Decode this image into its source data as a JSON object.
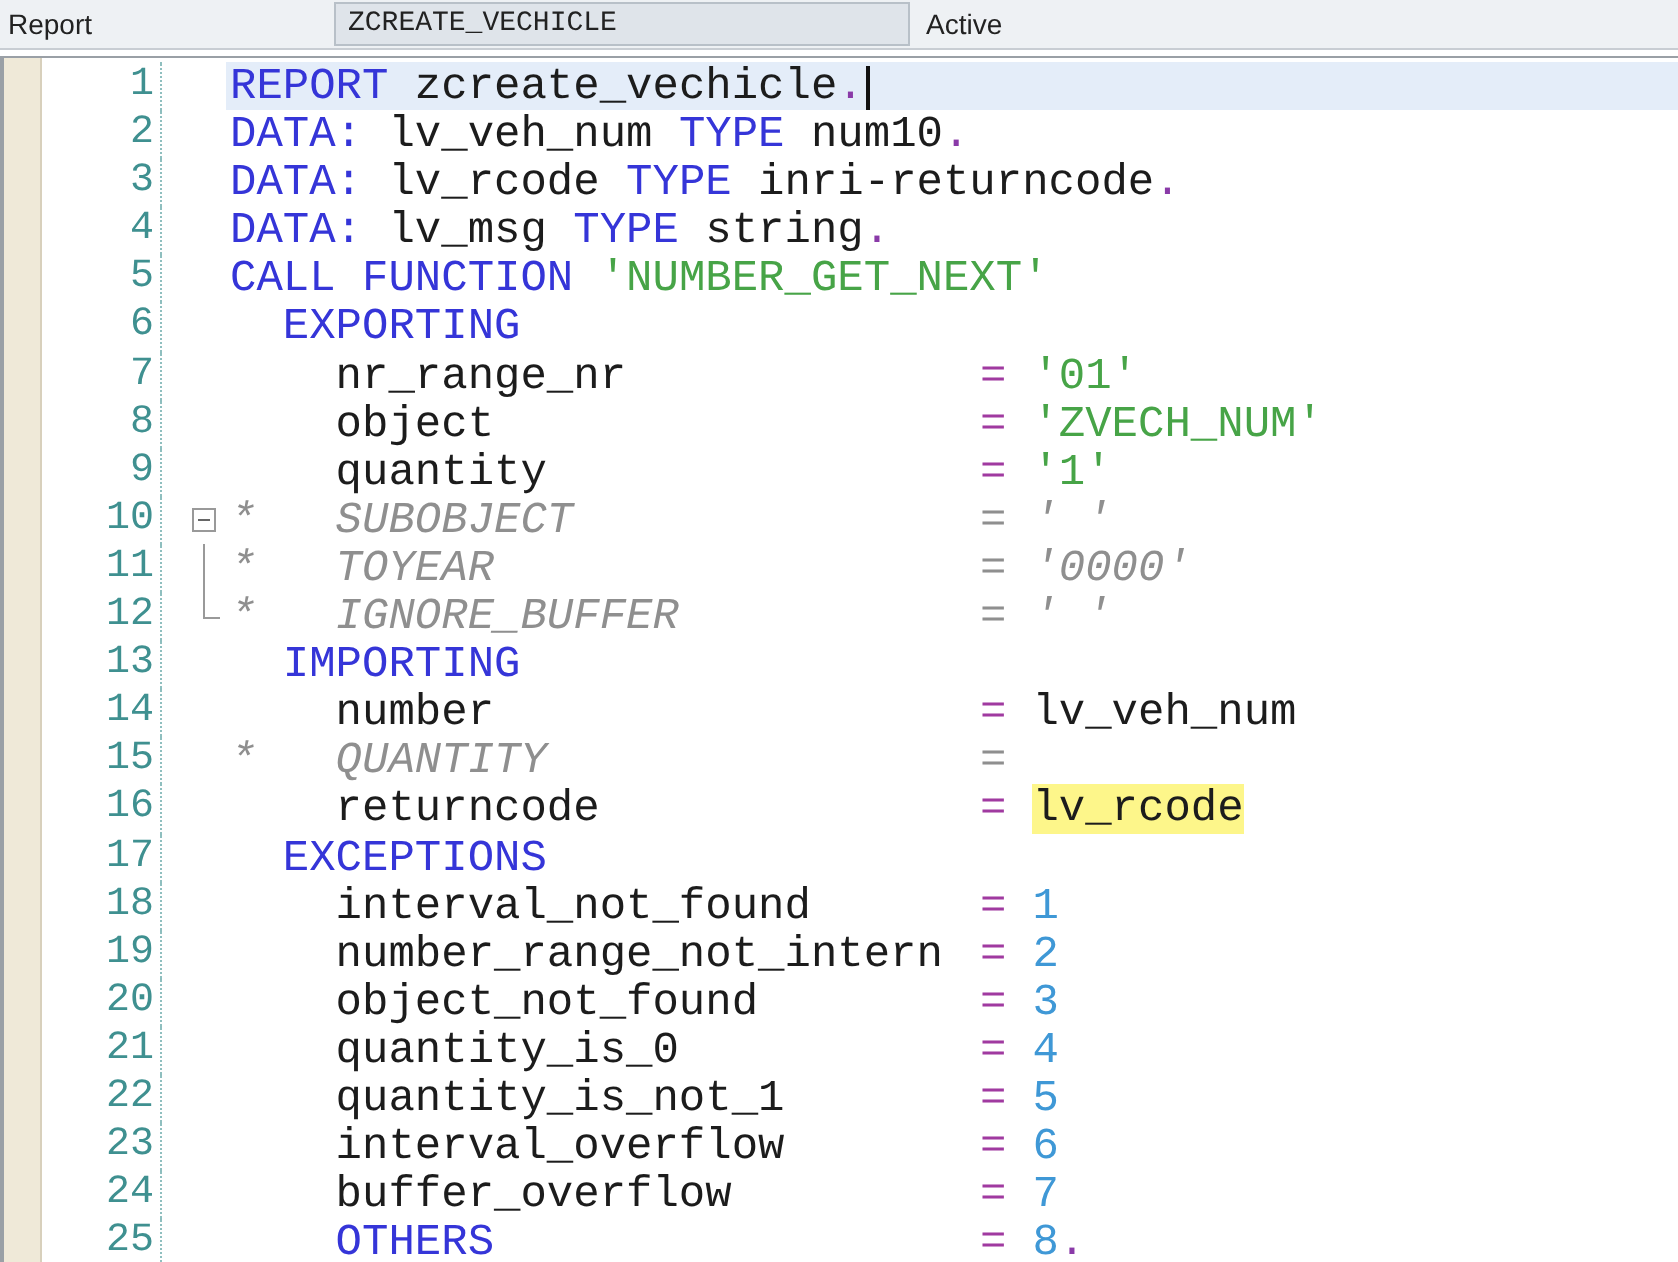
{
  "header": {
    "type_label": "Report",
    "program_name": "ZCREATE_VECHICLE",
    "status": "Active"
  },
  "lines": [
    {
      "number": "1",
      "current": true,
      "code": [
        {
          "text": "REPORT",
          "kind": "keyword"
        },
        {
          "text": " zcreate_vechicle",
          "kind": "plain"
        },
        {
          "text": ".",
          "kind": "punct"
        }
      ]
    },
    {
      "number": "2",
      "current": false,
      "code": [
        {
          "text": "DATA:",
          "kind": "keyword"
        },
        {
          "text": " lv_veh_num ",
          "kind": "plain"
        },
        {
          "text": "TYPE",
          "kind": "keyword"
        },
        {
          "text": " num10",
          "kind": "plain"
        },
        {
          "text": ".",
          "kind": "punct"
        }
      ]
    },
    {
      "number": "3",
      "current": false,
      "code": [
        {
          "text": "DATA:",
          "kind": "keyword"
        },
        {
          "text": " lv_rcode ",
          "kind": "plain"
        },
        {
          "text": "TYPE",
          "kind": "keyword"
        },
        {
          "text": " inri-returncode",
          "kind": "plain"
        },
        {
          "text": ".",
          "kind": "punct"
        }
      ]
    },
    {
      "number": "4",
      "current": false,
      "code": [
        {
          "text": "DATA:",
          "kind": "keyword"
        },
        {
          "text": " lv_msg ",
          "kind": "plain"
        },
        {
          "text": "TYPE",
          "kind": "keyword"
        },
        {
          "text": " string",
          "kind": "plain"
        },
        {
          "text": ".",
          "kind": "punct"
        }
      ]
    },
    {
      "number": "5",
      "current": false,
      "code": [
        {
          "text": "CALL FUNCTION ",
          "kind": "keyword"
        },
        {
          "text": "'NUMBER_GET_NEXT'",
          "kind": "string"
        }
      ]
    },
    {
      "number": "6",
      "current": false,
      "code": [
        {
          "text": "  EXPORTING",
          "kind": "keyword"
        }
      ]
    },
    {
      "number": "7",
      "current": false,
      "code": [
        {
          "text": "    nr_range_nr",
          "kind": "plain"
        }
      ],
      "assign": {
        "op": {
          "text": "=",
          "kind": "operator"
        },
        "value": [
          {
            "text": "'01'",
            "kind": "string"
          }
        ]
      }
    },
    {
      "number": "8",
      "current": false,
      "code": [
        {
          "text": "    object",
          "kind": "plain"
        }
      ],
      "assign": {
        "op": {
          "text": "=",
          "kind": "operator"
        },
        "value": [
          {
            "text": "'ZVECH_NUM'",
            "kind": "string"
          }
        ]
      }
    },
    {
      "number": "9",
      "current": false,
      "code": [
        {
          "text": "    quantity",
          "kind": "plain"
        }
      ],
      "assign": {
        "op": {
          "text": "=",
          "kind": "operator"
        },
        "value": [
          {
            "text": "'1'",
            "kind": "string"
          }
        ]
      }
    },
    {
      "number": "10",
      "current": false,
      "fold": {
        "kind": "start"
      },
      "code": [
        {
          "text": "*   SUBOBJECT",
          "kind": "comment"
        }
      ],
      "assign": {
        "op": {
          "text": "=",
          "kind": "comment"
        },
        "value": [
          {
            "text": "' '",
            "kind": "comment"
          }
        ]
      }
    },
    {
      "number": "11",
      "current": false,
      "fold": {
        "kind": "middle"
      },
      "code": [
        {
          "text": "*   TOYEAR",
          "kind": "comment"
        }
      ],
      "assign": {
        "op": {
          "text": "=",
          "kind": "comment"
        },
        "value": [
          {
            "text": "'0000'",
            "kind": "comment"
          }
        ]
      }
    },
    {
      "number": "12",
      "current": false,
      "fold": {
        "kind": "end"
      },
      "code": [
        {
          "text": "*   IGNORE_BUFFER",
          "kind": "comment"
        }
      ],
      "assign": {
        "op": {
          "text": "=",
          "kind": "comment"
        },
        "value": [
          {
            "text": "' '",
            "kind": "comment"
          }
        ]
      }
    },
    {
      "number": "13",
      "current": false,
      "code": [
        {
          "text": "  IMPORTING",
          "kind": "keyword"
        }
      ]
    },
    {
      "number": "14",
      "current": false,
      "code": [
        {
          "text": "    number",
          "kind": "plain"
        }
      ],
      "assign": {
        "op": {
          "text": "=",
          "kind": "operator"
        },
        "value": [
          {
            "text": "lv_veh_num",
            "kind": "plain"
          }
        ]
      }
    },
    {
      "number": "15",
      "current": false,
      "code": [
        {
          "text": "*   QUANTITY",
          "kind": "comment"
        }
      ],
      "assign": {
        "op": {
          "text": "=",
          "kind": "comment"
        }
      }
    },
    {
      "number": "16",
      "current": false,
      "code": [
        {
          "text": "    returncode",
          "kind": "plain"
        }
      ],
      "assign": {
        "op": {
          "text": "=",
          "kind": "operator"
        },
        "value": [
          {
            "text": "lv_rcode",
            "kind": "plain"
          }
        ],
        "highlighted": true
      }
    },
    {
      "number": "17",
      "current": false,
      "code": [
        {
          "text": "  EXCEPTIONS",
          "kind": "keyword"
        }
      ]
    },
    {
      "number": "18",
      "current": false,
      "code": [
        {
          "text": "    interval_not_found",
          "kind": "plain"
        }
      ],
      "assign": {
        "op": {
          "text": "=",
          "kind": "operator"
        },
        "value": [
          {
            "text": "1",
            "kind": "number"
          }
        ]
      }
    },
    {
      "number": "19",
      "current": false,
      "code": [
        {
          "text": "    number_range_not_intern",
          "kind": "plain"
        }
      ],
      "assign": {
        "op": {
          "text": "=",
          "kind": "operator"
        },
        "value": [
          {
            "text": "2",
            "kind": "number"
          }
        ]
      }
    },
    {
      "number": "20",
      "current": false,
      "code": [
        {
          "text": "    object_not_found",
          "kind": "plain"
        }
      ],
      "assign": {
        "op": {
          "text": "=",
          "kind": "operator"
        },
        "value": [
          {
            "text": "3",
            "kind": "number"
          }
        ]
      }
    },
    {
      "number": "21",
      "current": false,
      "code": [
        {
          "text": "    quantity_is_0",
          "kind": "plain"
        }
      ],
      "assign": {
        "op": {
          "text": "=",
          "kind": "operator"
        },
        "value": [
          {
            "text": "4",
            "kind": "number"
          }
        ]
      }
    },
    {
      "number": "22",
      "current": false,
      "code": [
        {
          "text": "    quantity_is_not_1",
          "kind": "plain"
        }
      ],
      "assign": {
        "op": {
          "text": "=",
          "kind": "operator"
        },
        "value": [
          {
            "text": "5",
            "kind": "number"
          }
        ]
      }
    },
    {
      "number": "23",
      "current": false,
      "code": [
        {
          "text": "    interval_overflow",
          "kind": "plain"
        }
      ],
      "assign": {
        "op": {
          "text": "=",
          "kind": "operator"
        },
        "value": [
          {
            "text": "6",
            "kind": "number"
          }
        ]
      }
    },
    {
      "number": "24",
      "current": false,
      "code": [
        {
          "text": "    buffer_overflow",
          "kind": "plain"
        }
      ],
      "assign": {
        "op": {
          "text": "=",
          "kind": "operator"
        },
        "value": [
          {
            "text": "7",
            "kind": "number"
          }
        ]
      }
    },
    {
      "number": "25",
      "current": false,
      "code": [
        {
          "text": "    OTHERS",
          "kind": "keyword"
        }
      ],
      "assign": {
        "op": {
          "text": "=",
          "kind": "operator"
        },
        "value": [
          {
            "text": "8",
            "kind": "number"
          },
          {
            "text": ".",
            "kind": "punct"
          }
        ]
      }
    }
  ]
}
